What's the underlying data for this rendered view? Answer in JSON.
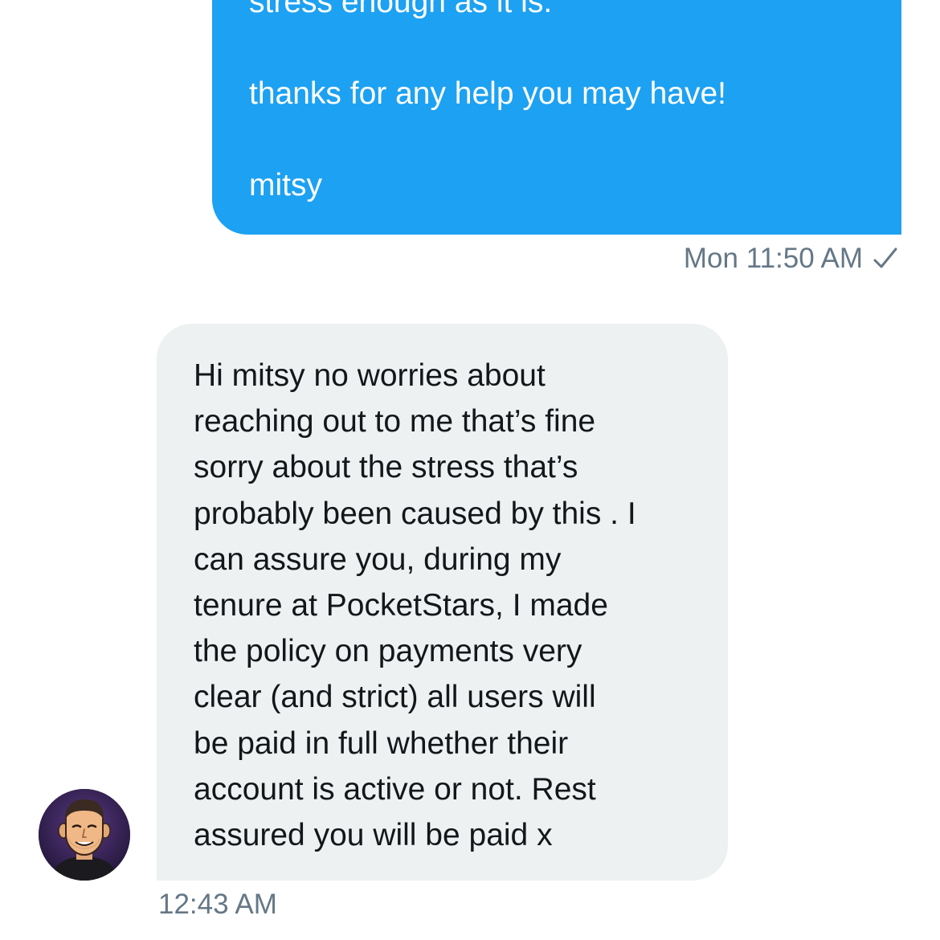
{
  "conversation": {
    "sent_message": {
      "clipped_line": "stress enough as it is.",
      "thanks_line": "thanks for any help you may have!",
      "signature": "mitsy",
      "timestamp": "Mon 11:50 AM",
      "status_icon": "checkmark-icon"
    },
    "received_message": {
      "lines": [
        "Hi mitsy no worries about",
        "reaching out to me that’s fine",
        "sorry about the stress that’s",
        "probably been caused by this . I",
        "can assure you, during my",
        "tenure at PocketStars, I made",
        "the policy on payments very",
        "clear (and strict) all users will",
        "be paid in full whether their",
        "account is active or not. Rest",
        "assured you will be paid x"
      ],
      "timestamp": "12:43 AM",
      "avatar_icon": "cartoon-avatar-icon"
    },
    "colors": {
      "sent_bubble": "#1da1f2",
      "received_bubble": "#edf1f2",
      "meta_text": "#657786"
    }
  }
}
